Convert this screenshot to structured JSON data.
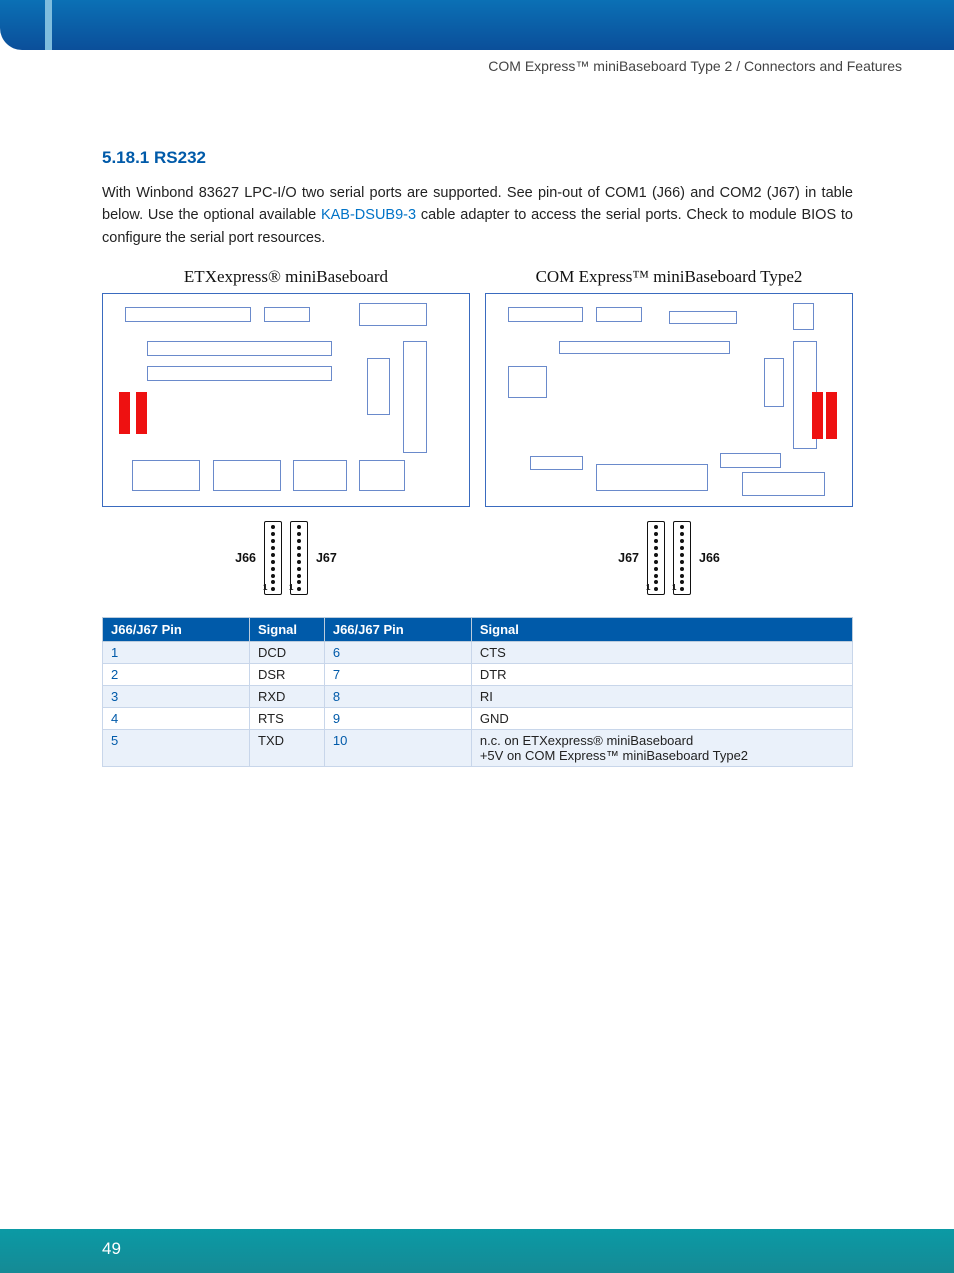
{
  "header": {
    "breadcrumb": "COM Express™ miniBaseboard Type 2 / Connectors and Features"
  },
  "section": {
    "number": "5.18.1",
    "title": "RS232"
  },
  "paragraph": {
    "pre": "With Winbond 83627 LPC-I/O two serial ports are supported. See pin-out of COM1 (J66) and COM2 (J67) in table below. Use the optional available ",
    "link": "KAB-DSUB9-3",
    "post": " cable adapter to access the serial ports. Check to module BIOS to configure the serial port resources."
  },
  "diagrams": {
    "left_title": "ETXexpress® miniBaseboard",
    "right_title": "COM Express™ miniBaseboard Type2",
    "left_conn_left": "J66",
    "left_conn_right": "J67",
    "right_conn_left": "J67",
    "right_conn_right": "J66"
  },
  "table": {
    "headers": [
      "J66/J67 Pin",
      "Signal",
      "J66/J67 Pin",
      "Signal"
    ],
    "rows": [
      {
        "a": "1",
        "as": "DCD",
        "b": "6",
        "bs": "CTS"
      },
      {
        "a": "2",
        "as": "DSR",
        "b": "7",
        "bs": "DTR"
      },
      {
        "a": "3",
        "as": "RXD",
        "b": "8",
        "bs": "RI"
      },
      {
        "a": "4",
        "as": "RTS",
        "b": "9",
        "bs": "GND"
      },
      {
        "a": "5",
        "as": "TXD",
        "b": "10",
        "bs": "n.c. on ETXexpress® miniBaseboard\n+5V on COM Express™ miniBaseboard Type2"
      }
    ]
  },
  "footer": {
    "page": "49"
  }
}
